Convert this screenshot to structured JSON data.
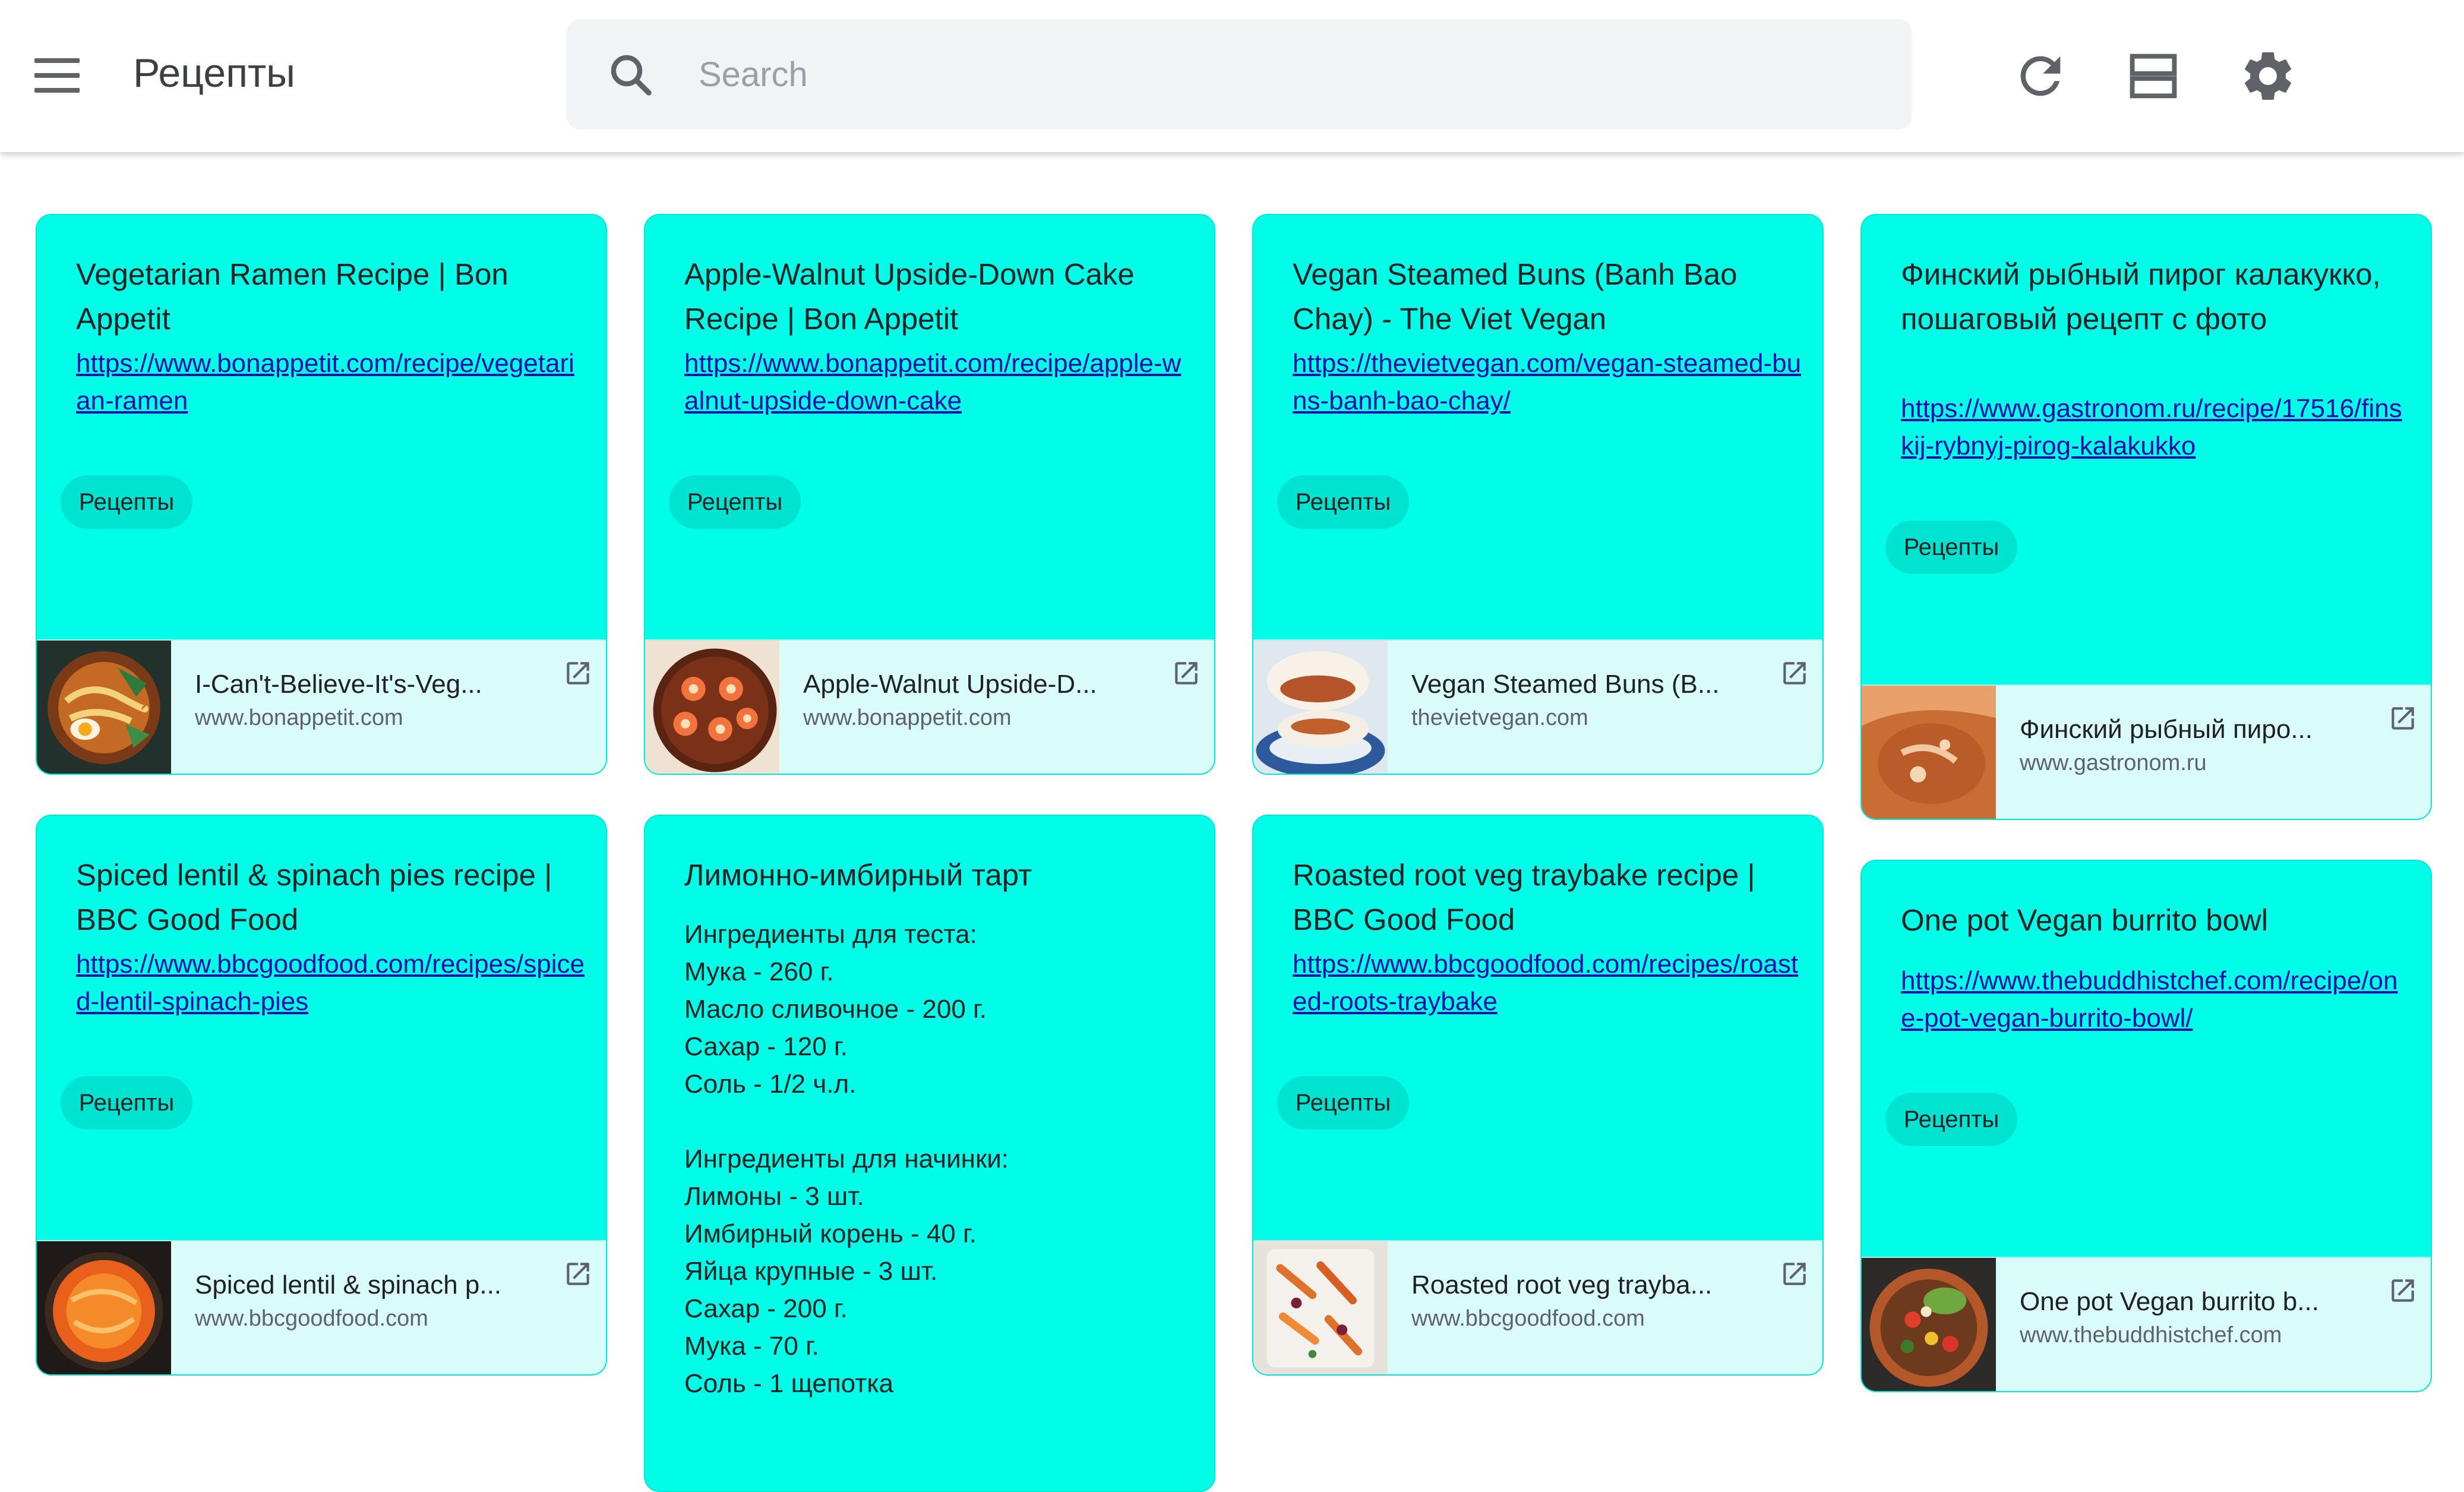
{
  "app": {
    "title": "Рецепты"
  },
  "search": {
    "placeholder": "Search"
  },
  "toolbar": {
    "refresh_icon": "refresh-icon",
    "list_view_icon": "list-view-icon",
    "settings_icon": "gear-icon"
  },
  "colors": {
    "card_bg": "#00fde8",
    "preview_bg": "#d9fcf9",
    "chip_bg": "#00e3d0",
    "link": "#1a0dab"
  },
  "cards": [
    {
      "title": "Vegetarian Ramen Recipe | Bon Appetit",
      "url": "https://www.bonappetit.com/recipe/vegetarian-ramen",
      "label": "Рецепты",
      "preview_title": "I-Can't-Believe-It's-Veg...",
      "preview_domain": "www.bonappetit.com"
    },
    {
      "title": "Apple-Walnut Upside-Down Cake Recipe | Bon Appetit",
      "url": "https://www.bonappetit.com/recipe/apple-walnut-upside-down-cake",
      "label": "Рецепты",
      "preview_title": "Apple-Walnut Upside-D...",
      "preview_domain": "www.bonappetit.com"
    },
    {
      "title": "Vegan Steamed Buns (Banh Bao Chay) - The Viet Vegan",
      "url": "https://thevietvegan.com/vegan-steamed-buns-banh-bao-chay/",
      "label": "Рецепты",
      "preview_title": "Vegan Steamed Buns (B...",
      "preview_domain": "thevietvegan.com"
    },
    {
      "title": "Финский рыбный пирог калакукко, пошаговый рецепт с фото",
      "url": "https://www.gastronom.ru/recipe/17516/finskij-rybnyj-pirog-kalakukko",
      "label": "Рецепты",
      "preview_title": "Финский рыбный пиро...",
      "preview_domain": "www.gastronom.ru"
    },
    {
      "title": "Spiced lentil & spinach pies recipe | BBC Good Food",
      "url": "https://www.bbcgoodfood.com/recipes/spiced-lentil-spinach-pies",
      "label": "Рецепты",
      "preview_title": "Spiced lentil & spinach p...",
      "preview_domain": "www.bbcgoodfood.com"
    },
    {
      "title": "Лимонно-имбирный тарт",
      "body": "Ингредиенты для теста:\nМука - 260 г.\nМасло сливочное - 200 г.\nСахар - 120 г.\nСоль - 1/2 ч.л.\n\nИнгредиенты для начинки:\nЛимоны - 3 шт.\nИмбирный корень - 40 г.\nЯйца крупные - 3 шт.\nСахар - 200 г.\nМука - 70 г.\nСоль - 1 щепотка"
    },
    {
      "title": "Roasted root veg traybake recipe | BBC Good Food",
      "url": "https://www.bbcgoodfood.com/recipes/roasted-roots-traybake",
      "label": "Рецепты",
      "preview_title": "Roasted root veg trayba...",
      "preview_domain": "www.bbcgoodfood.com"
    },
    {
      "title": "One pot Vegan burrito bowl",
      "url": "https://www.thebuddhistchef.com/recipe/one-pot-vegan-burrito-bowl/",
      "label": "Рецепты",
      "preview_title": "One pot Vegan burrito b...",
      "preview_domain": "www.thebuddhistchef.com"
    }
  ]
}
